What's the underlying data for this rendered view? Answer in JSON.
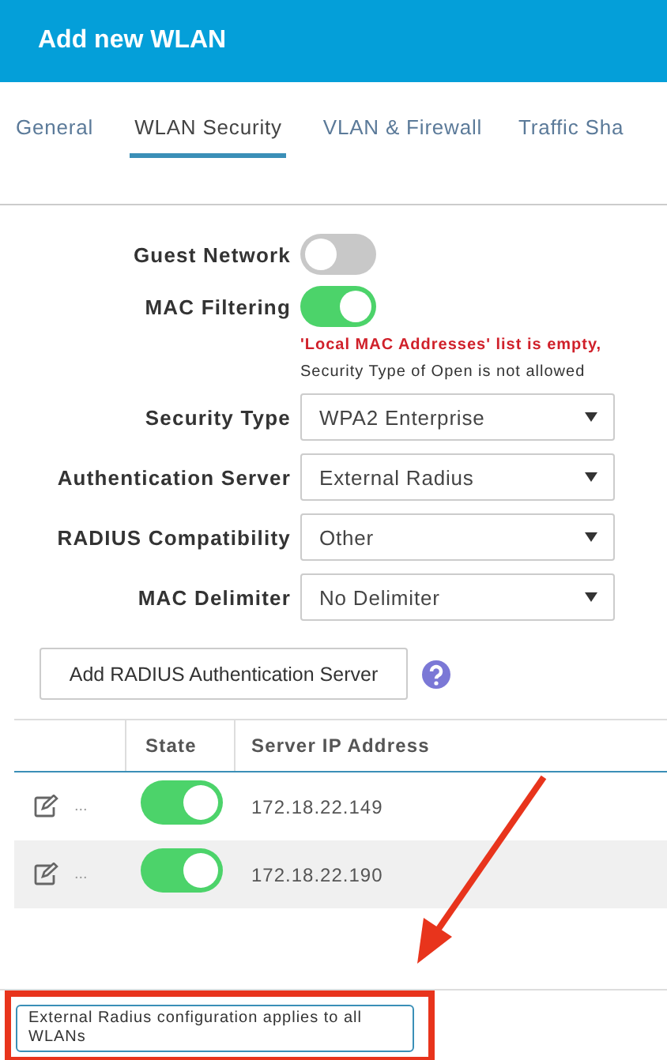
{
  "header": {
    "title": "Add new WLAN"
  },
  "tabs": [
    {
      "label": "General",
      "selected": false
    },
    {
      "label": "WLAN Security",
      "selected": true
    },
    {
      "label": "VLAN & Firewall",
      "selected": false
    },
    {
      "label": "Traffic Sha",
      "selected": false
    }
  ],
  "toggles": [
    {
      "label": "Guest Network",
      "on": false
    },
    {
      "label": "MAC Filtering",
      "on": true
    }
  ],
  "messages": [
    {
      "kind": "error",
      "text": "'Local MAC Addresses' list is empty,"
    },
    {
      "kind": "info",
      "text": "Security Type of Open is not allowed"
    }
  ],
  "selects": [
    {
      "label": "Security Type",
      "value": "WPA2 Enterprise"
    },
    {
      "label": "Authentication Server",
      "value": "External Radius"
    },
    {
      "label": "RADIUS Compatibility",
      "value": "Other"
    },
    {
      "label": "MAC Delimiter",
      "value": "No Delimiter"
    }
  ],
  "add_button": "Add RADIUS Authentication Server",
  "table": {
    "columns": [
      "State",
      "Server IP Address"
    ],
    "rows": [
      {
        "more": "...",
        "on": true,
        "address": "172.18.22.149"
      },
      {
        "more": "...",
        "on": true,
        "address": "172.18.22.190"
      }
    ]
  },
  "note": "External Radius configuration applies to all WLANs"
}
